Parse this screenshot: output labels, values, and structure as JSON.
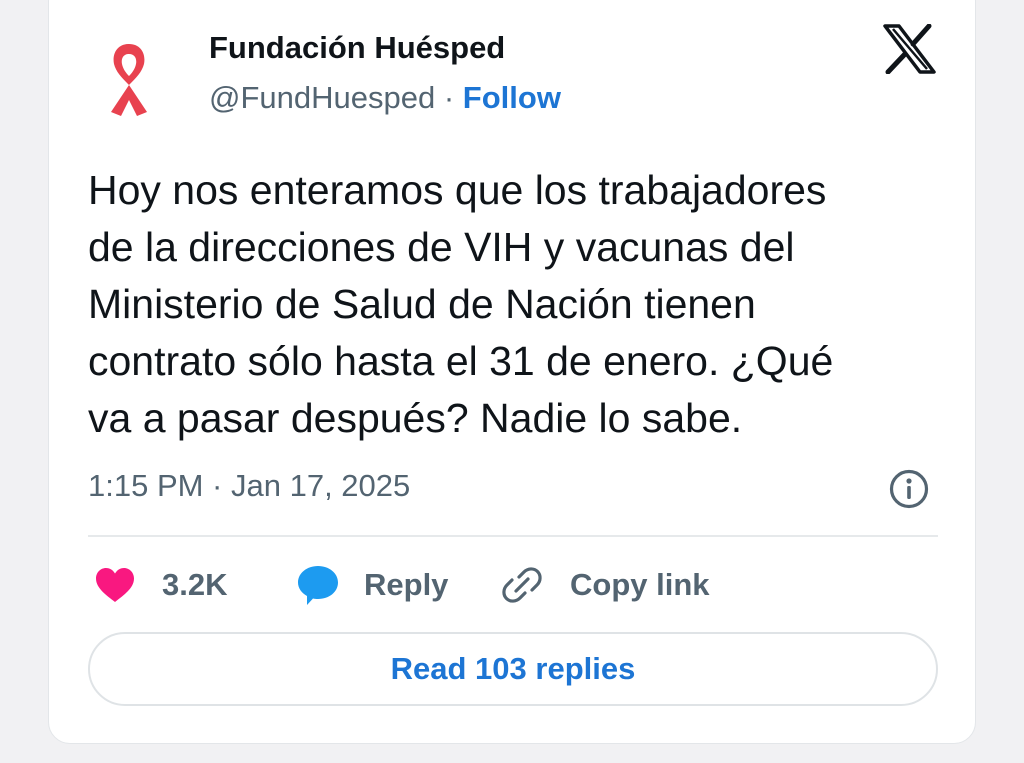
{
  "account": {
    "name": "Fundación Huésped",
    "handle": "@FundHuesped",
    "separator": "·",
    "follow_label": "Follow",
    "avatar_icon": "red-ribbon-icon"
  },
  "platform_icon": "x-logo-icon",
  "tweet": {
    "lines": [
      "Hoy nos enteramos que los trabajadores",
      "de la direcciones de VIH y vacunas del",
      "Ministerio de Salud de Nación tienen",
      "contrato sólo hasta el 31 de enero. ¿Qué",
      "va a pasar después? Nadie lo sabe."
    ],
    "timestamp": "1:15 PM · Jan 17, 2025"
  },
  "actions": {
    "likes_count": "3.2K",
    "reply_label": "Reply",
    "copy_link_label": "Copy link"
  },
  "read_replies_label": "Read 103 replies",
  "colors": {
    "accent_blue": "#1d75d4",
    "heart_pink": "#f91880",
    "reply_bubble_blue": "#1d9bf0",
    "ribbon_red": "#e8424f",
    "text_primary": "#0f1419",
    "text_secondary": "#536471"
  }
}
